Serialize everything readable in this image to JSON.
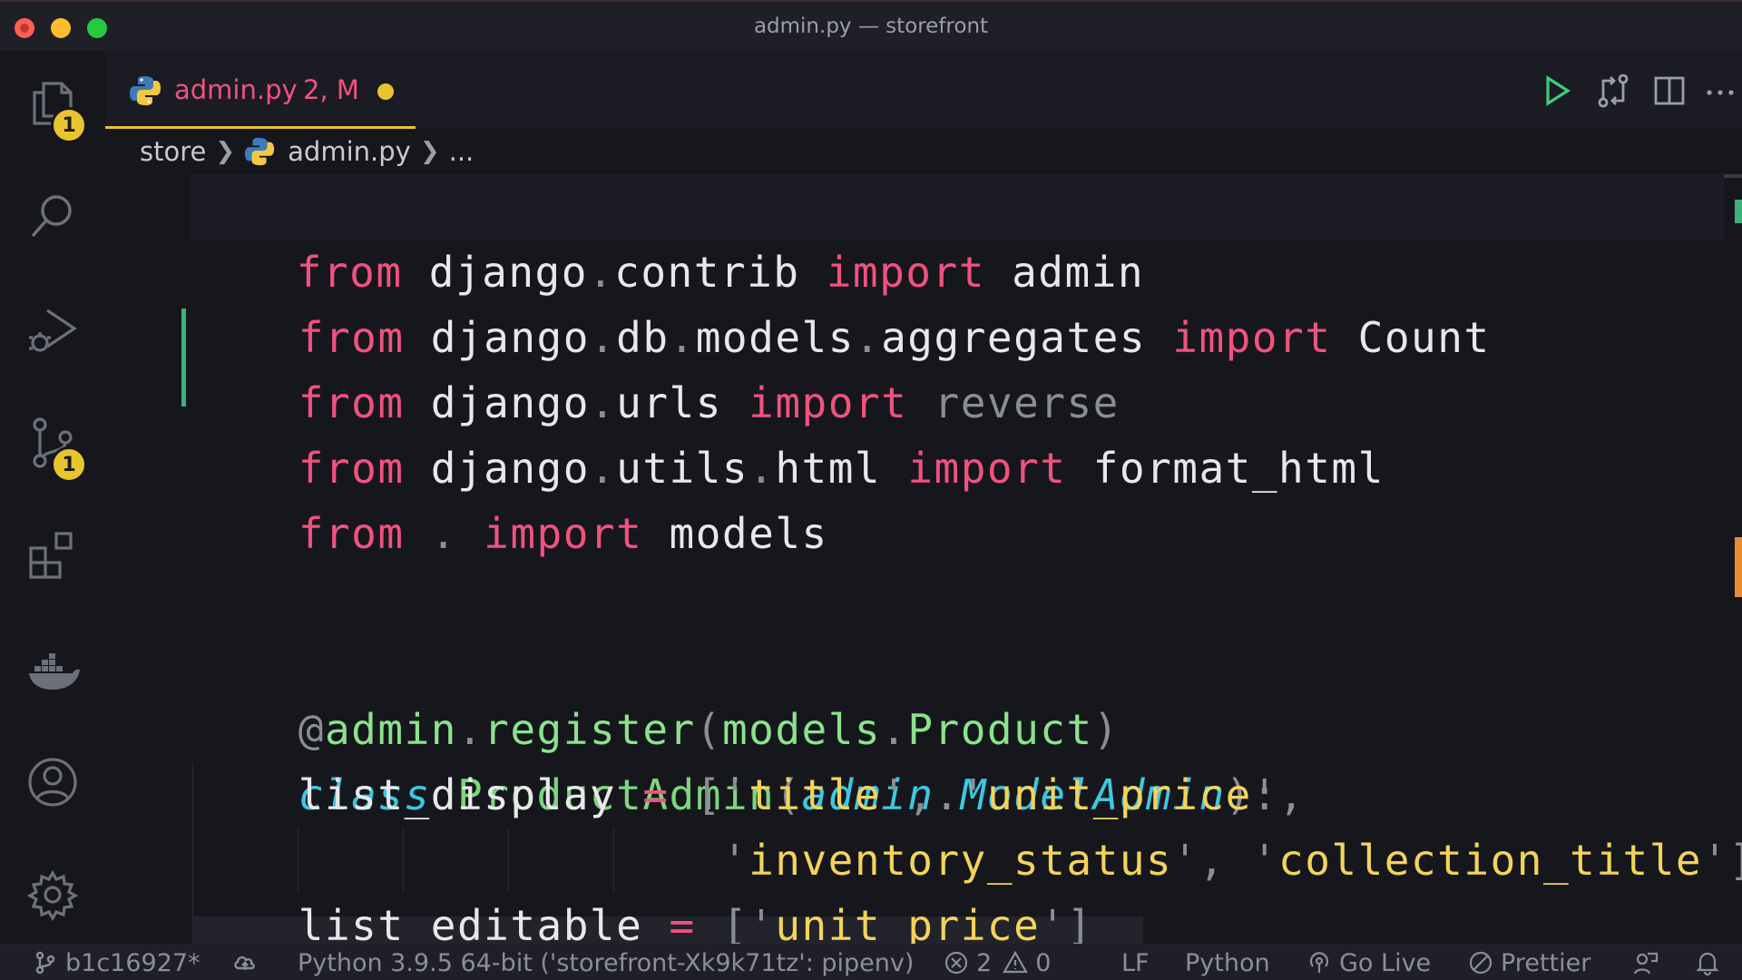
{
  "window": {
    "title": "admin.py — storefront"
  },
  "activity": {
    "explorer_badge": "1",
    "scm_badge": "1"
  },
  "tab": {
    "filename": "admin.py",
    "status": "2, M"
  },
  "breadcrumb": {
    "folder": "store",
    "file": "admin.py",
    "more": "..."
  },
  "code": {
    "l1": {
      "from": "from",
      "mod1": "django",
      "d1": ".",
      "mod2": "contrib",
      "imp": "import",
      "name": "admin"
    },
    "l2": {
      "from": "from",
      "mod1": "django",
      "d1": ".",
      "mod2": "db",
      "d2": ".",
      "mod3": "models",
      "d3": ".",
      "mod4": "aggregates",
      "imp": "import",
      "name": "Count"
    },
    "l3": {
      "from": "from",
      "mod1": "django",
      "d1": ".",
      "mod2": "urls",
      "imp": "import",
      "name": "reverse"
    },
    "l4": {
      "from": "from",
      "mod1": "django",
      "d1": ".",
      "mod2": "utils",
      "d2": ".",
      "mod3": "html",
      "imp": "import",
      "name": "format_html"
    },
    "l5": {
      "from": "from",
      "d1": ".",
      "imp": "import",
      "name": "models"
    },
    "l6": {
      "at": "@",
      "obj": "admin",
      "d1": ".",
      "fn": "register",
      "p1": "(",
      "arg1": "models",
      "d2": ".",
      "arg2": "Product",
      "p2": ")"
    },
    "l7": {
      "kw": "class",
      "name": "ProductAdmin",
      "p1": "(",
      "base1": "admin",
      "d1": ".",
      "base2": "ModelAdmin",
      "p2": ")",
      "colon": ":"
    },
    "l8": {
      "name": "list_display",
      "eq": "=",
      "b1": "[",
      "q1": "'",
      "s1": "title",
      "q2": "'",
      "c1": ",",
      "q3": "'",
      "s2": "unit_price",
      "q4": "'",
      "c2": ","
    },
    "l9": {
      "q1": "'",
      "s1": "inventory_status",
      "q2": "'",
      "c1": ",",
      "q3": "'",
      "s2": "collection_title",
      "q4": "'",
      "b2": "]"
    },
    "l10": {
      "name": "list editable",
      "eq": "=",
      "b1": "[",
      "q1": "'",
      "s1": "unit price",
      "q2": "'",
      "b2": "]"
    }
  },
  "status": {
    "branch": "b1c16927*",
    "interpreter": "Python 3.9.5 64-bit ('storefront-Xk9k71tz': pipenv)",
    "errors": "2",
    "warnings": "0",
    "eol": "LF",
    "language": "Python",
    "golive": "Go Live",
    "prettier": "Prettier"
  },
  "colors": {
    "keyword": "#f0527f",
    "string": "#f3d35b",
    "function": "#8be38b",
    "italic_class": "#3fc7e0",
    "badge": "#e8c52e",
    "git_added": "#3fb07a"
  }
}
